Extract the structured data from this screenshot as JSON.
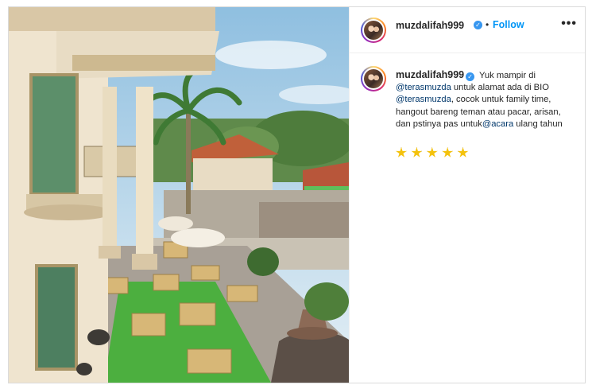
{
  "post": {
    "username": "muzdalifah999",
    "verified_mark": "✓",
    "dot": "•",
    "follow_label": "Follow",
    "more_label": "•••"
  },
  "caption": {
    "username": "muzdalifah999",
    "text_1": "Yuk mampir di",
    "mention_1": "@terasmuzda",
    "text_2": "untuk alamat ada di BIO",
    "mention_2": "@terasmuzda",
    "text_3": ", cocok untuk family time, hangout bareng teman atau pacar, arisan, dan pstinya pas untuk",
    "mention_3": "@acara",
    "text_4": "ulang tahun",
    "star_count": 5
  },
  "icons": {
    "more": "more-options-icon",
    "verified": "verified-badge-icon",
    "star": "star-emoji-icon"
  },
  "colors": {
    "follow": "#0095f6",
    "mention": "#00376b",
    "verified": "#3897f0",
    "grass": "#4caf3f",
    "star": "#f4c20d"
  }
}
